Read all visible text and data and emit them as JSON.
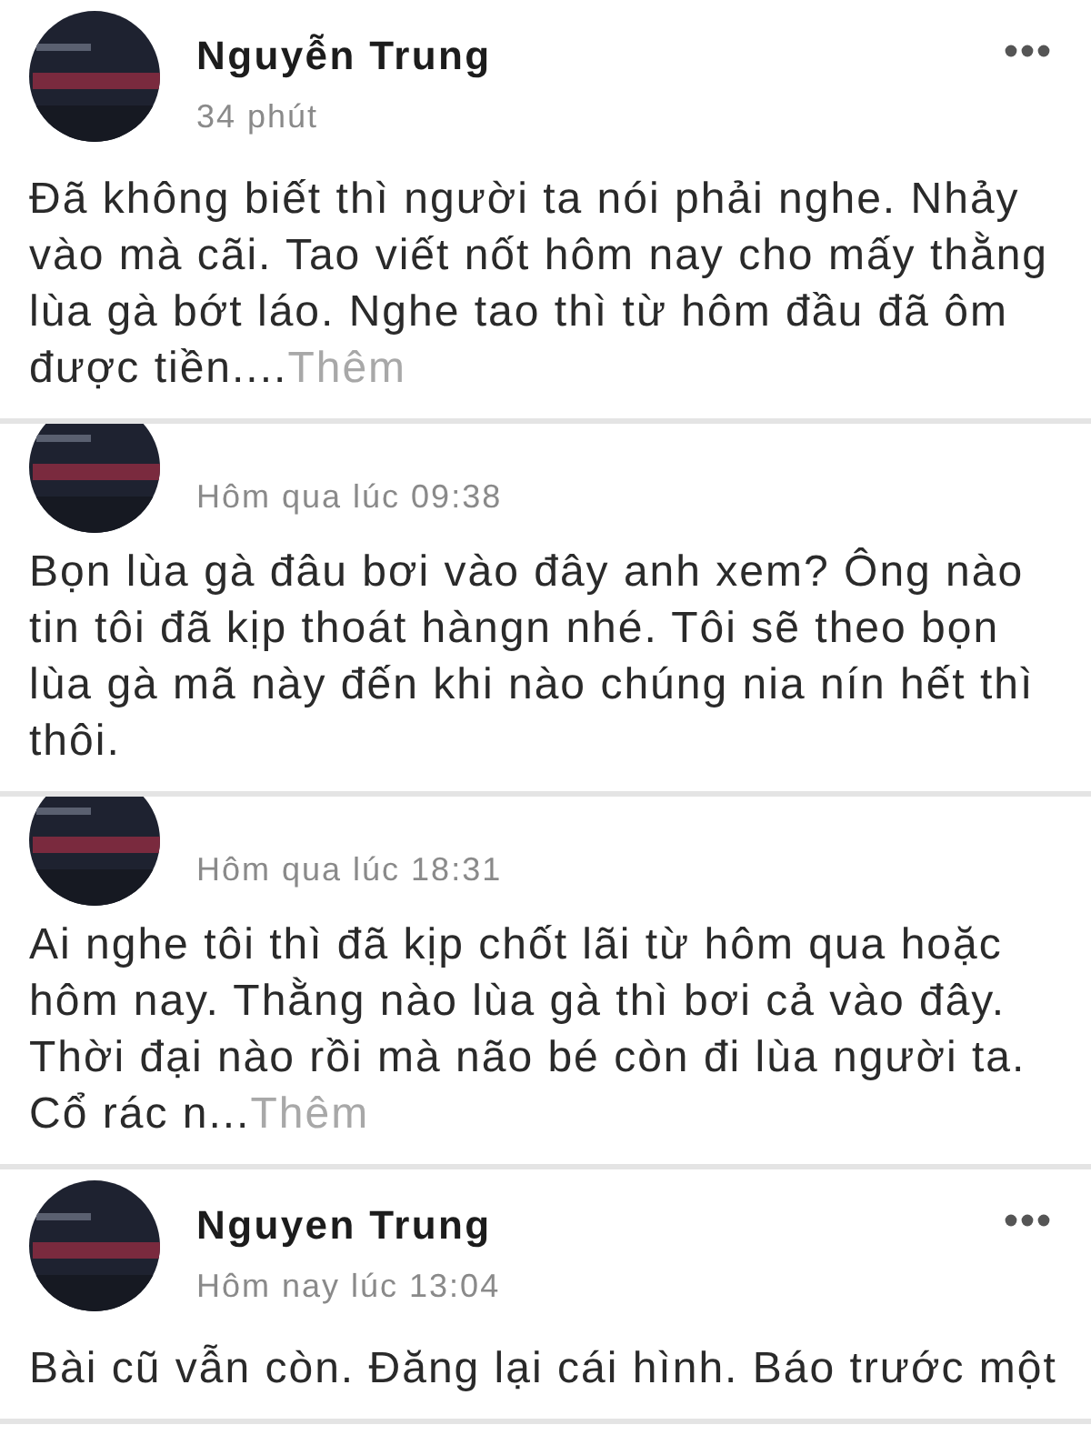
{
  "posts": [
    {
      "name": "Nguyễn Trung",
      "time": "34 phút",
      "menu": true,
      "clipped": false,
      "body": "Đã không biết thì người ta nói phải nghe. Nhảy vào mà cãi. Tao viết nốt hôm nay cho mấy thằng lùa gà bớt láo. Nghe tao thì từ hôm đầu đã ôm được tiền....",
      "more": "Thêm"
    },
    {
      "time": "Hôm qua lúc 09:38",
      "menu": false,
      "clipped": true,
      "body": "Bọn lùa gà đâu bơi vào đây anh xem? Ông nào tin tôi đã kịp thoát hàngn nhé. Tôi sẽ theo bọn lùa gà mã này đến khi nào chúng nia nín hết thì thôi."
    },
    {
      "time": "Hôm qua lúc 18:31",
      "menu": false,
      "clipped": true,
      "body": "Ai nghe tôi thì đã kịp chốt lãi từ hôm qua hoặc hôm nay. Thằng nào lùa gà thì bơi cả vào đây. Thời đại nào rồi mà não bé còn đi lùa người ta. Cổ rác n...",
      "more": "Thêm"
    },
    {
      "name": "Nguyen Trung",
      "time": "Hôm nay lúc 13:04",
      "menu": true,
      "clipped": false,
      "body": "Bài cũ vẫn còn. Đăng lại cái hình. Báo trước một"
    }
  ]
}
